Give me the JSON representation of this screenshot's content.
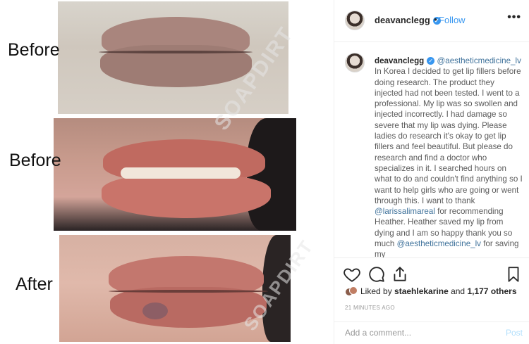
{
  "media": {
    "labels": {
      "before_1": "Before",
      "before_2": "Before",
      "after": "After"
    },
    "watermark": "SOAPDIRT"
  },
  "post": {
    "header": {
      "username": "deavanclegg",
      "separator": "•",
      "follow_label": "Follow",
      "more_label": "•••"
    },
    "caption": {
      "username": "deavanclegg",
      "mention_1": "@aestheticmedicine_lv",
      "text_1": " In Korea I decided to get lip fillers before doing research. The product they injected had not been tested. I went to a professional. My lip was so swollen and injected incorrectly. I had damage so severe that my lip was dying. Please ladies do research it's okay to get lip fillers and feel beautiful. But please do research and find a doctor who specializes in it. I searched hours on what to do and couldn't find anything so I want to help girls who are going or went through this. I want to thank ",
      "mention_2": "@larissalimareal",
      "text_2": " for recommending Heather. Heather saved my lip from dying and I am so happy thank you so much ",
      "mention_3": "@aestheticmedicine_lv",
      "text_3": " for saving my"
    },
    "likes": {
      "prefix": "Liked by ",
      "user": "staehlekarine",
      "middle": " and ",
      "count": "1,177 others"
    },
    "timestamp": "21 MINUTES AGO",
    "comment": {
      "placeholder": "Add a comment...",
      "post_label": "Post"
    },
    "icons": [
      "heart-icon",
      "comment-icon",
      "share-icon",
      "bookmark-icon",
      "verified-icon"
    ],
    "colors": {
      "link": "#3897f0",
      "mention": "#3f729b",
      "verified": "#3897f0"
    }
  }
}
